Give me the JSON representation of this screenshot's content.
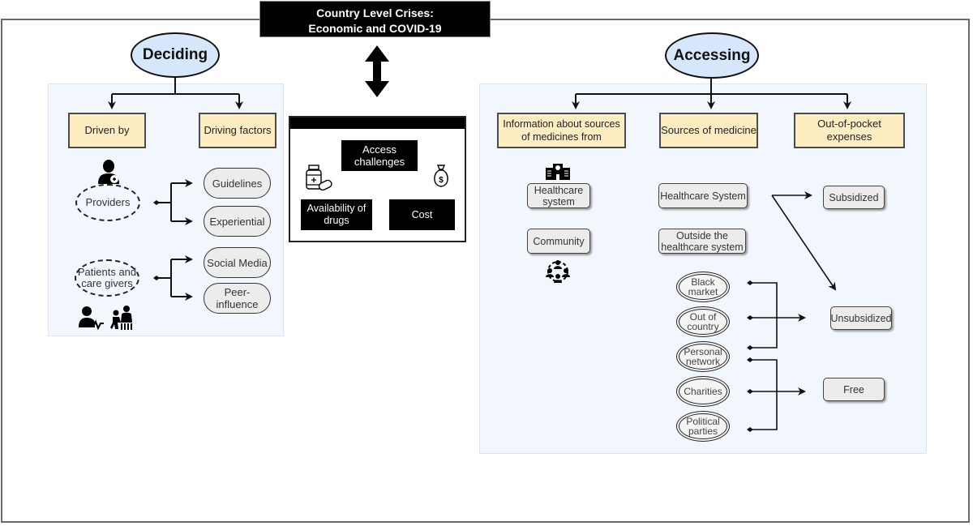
{
  "header": {
    "crisis_title_line1": "Country Level Crises:",
    "crisis_title_line2": "Economic and COVID-19"
  },
  "deciding": {
    "title": "Deciding",
    "categories": [
      "Driven by",
      "Driving factors"
    ],
    "actors": [
      {
        "label": "Providers",
        "icon": "doctor-icon",
        "factors": [
          "Guidelines",
          "Experiential"
        ]
      },
      {
        "label": "Patients and care givers",
        "icon": "patient-caregiver-icon",
        "factors": [
          "Social Media",
          "Peer-influence"
        ]
      }
    ]
  },
  "access_challenges": {
    "title": "Access challenges",
    "items": [
      {
        "label": "Availability of drugs",
        "icon": "medicine-bottle-icon"
      },
      {
        "label": "Cost",
        "icon": "money-bag-icon"
      }
    ]
  },
  "accessing": {
    "title": "Accessing",
    "categories": [
      "Information about sources of medicines from",
      "Sources of medicine",
      "Out-of-pocket expenses"
    ],
    "information_sources": [
      {
        "label": "Healthcare system",
        "icon": "hospital-icon"
      },
      {
        "label": "Community",
        "icon": "community-icon"
      }
    ],
    "medicine_sources": [
      "Healthcare System",
      "Outside the healthcare system"
    ],
    "outside_channels": [
      "Black market",
      "Out of country",
      "Personal network",
      "Charities",
      "Political parties"
    ],
    "expense_types": [
      "Subsidized",
      "Unsubsidized",
      "Free"
    ]
  }
}
